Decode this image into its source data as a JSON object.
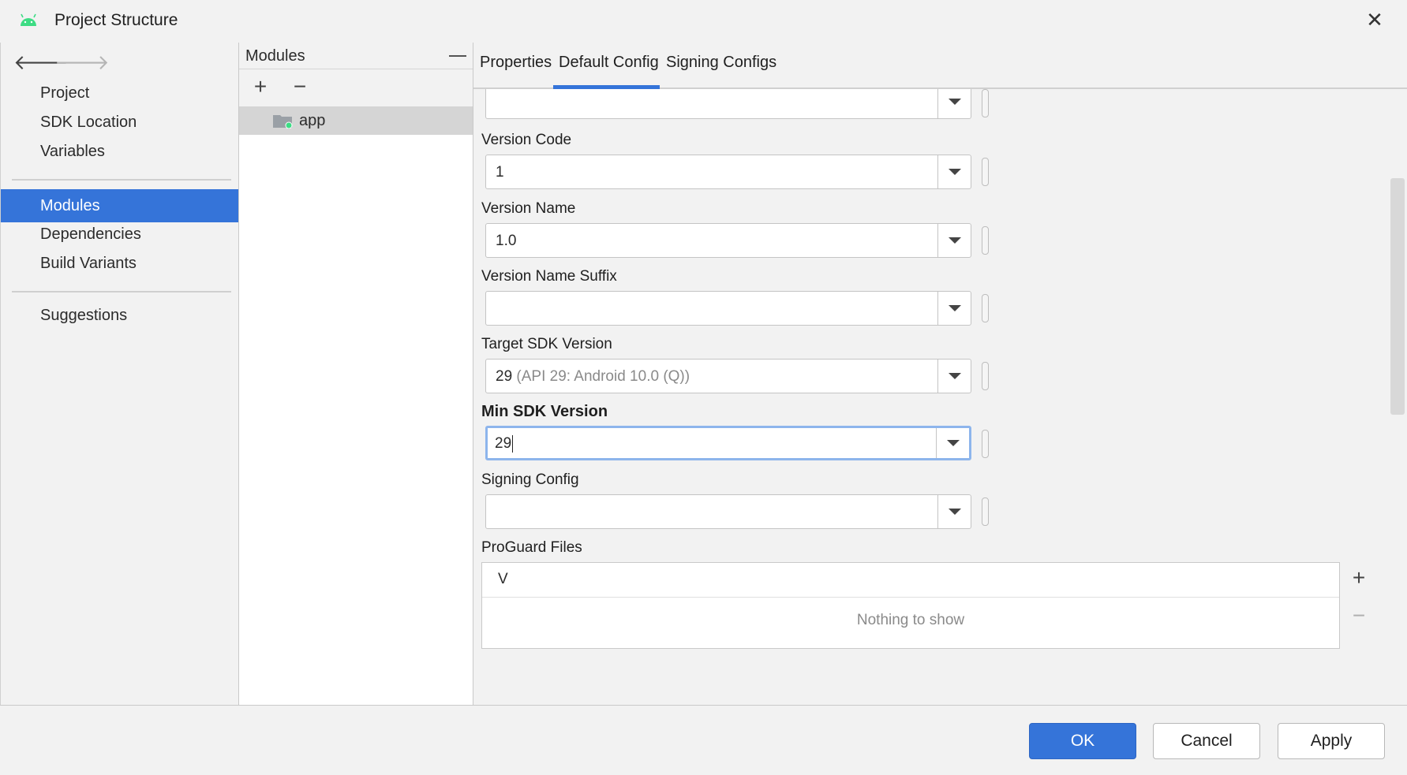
{
  "window": {
    "title": "Project Structure",
    "close_glyph": "✕",
    "app_icon": "android-icon"
  },
  "nav": {
    "back_glyph": "🡐",
    "forward_glyph": "🡒",
    "items_top": [
      "Project",
      "SDK Location",
      "Variables"
    ],
    "items_mid": [
      "Modules",
      "Dependencies",
      "Build Variants"
    ],
    "items_bottom": [
      "Suggestions"
    ],
    "selected": "Modules"
  },
  "modules_panel": {
    "title": "Modules",
    "add_glyph": "+",
    "remove_glyph": "−",
    "items": [
      {
        "name": "app",
        "icon": "folder-icon"
      }
    ]
  },
  "tabs": [
    "Properties",
    "Default Config",
    "Signing Configs"
  ],
  "active_tab": "Default Config",
  "form": {
    "fields": [
      {
        "label": "",
        "value": "",
        "hint": ""
      },
      {
        "label": "Version Code",
        "value": "1",
        "hint": ""
      },
      {
        "label": "Version Name",
        "value": "1.0",
        "hint": ""
      },
      {
        "label": "Version Name Suffix",
        "value": "",
        "hint": ""
      },
      {
        "label": "Target SDK Version",
        "value": "29",
        "hint": " (API 29: Android 10.0 (Q))"
      },
      {
        "label": "Min SDK Version",
        "value": "29",
        "hint": ""
      },
      {
        "label": "Signing Config",
        "value": "",
        "hint": ""
      }
    ],
    "proguard": {
      "label": "ProGuard Files",
      "column": "V",
      "empty_text": "Nothing to show",
      "add_glyph": "+",
      "remove_glyph": "−"
    }
  },
  "buttons": {
    "ok": "OK",
    "cancel": "Cancel",
    "apply": "Apply"
  },
  "colors": {
    "accent": "#3574d9",
    "focus": "#8db5ec",
    "android_green": "#3ddc84"
  }
}
